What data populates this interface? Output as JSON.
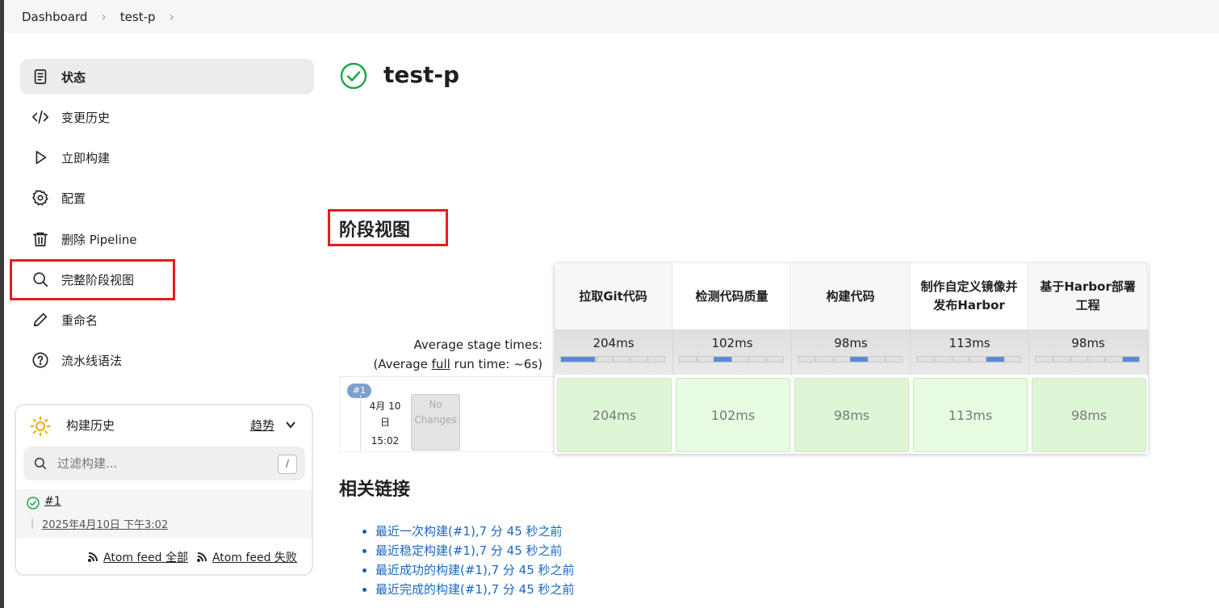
{
  "breadcrumb": {
    "items": [
      "Dashboard",
      "test-p"
    ]
  },
  "sidebar": {
    "items": [
      {
        "label": "状态",
        "icon": "status-doc-icon"
      },
      {
        "label": "变更历史",
        "icon": "code-icon"
      },
      {
        "label": "立即构建",
        "icon": "play-icon"
      },
      {
        "label": "配置",
        "icon": "gear-icon"
      },
      {
        "label": "删除 Pipeline",
        "icon": "trash-icon"
      },
      {
        "label": "完整阶段视图",
        "icon": "search-icon"
      },
      {
        "label": "重命名",
        "icon": "pencil-icon"
      },
      {
        "label": "流水线语法",
        "icon": "help-icon"
      }
    ]
  },
  "build_history": {
    "title": "构建历史",
    "trend_label": "趋势",
    "filter_placeholder": "过滤构建...",
    "filter_shortcut": "/",
    "builds": [
      {
        "number": "#1",
        "date": "2025年4月10日 下午3:02",
        "status": "success"
      }
    ],
    "feeds": [
      "Atom feed 全部",
      "Atom feed 失败"
    ]
  },
  "main": {
    "title": "test-p",
    "stage_view_title": "阶段视图",
    "avg_stage_label": "Average stage times:",
    "avg_full_prefix": "(Average ",
    "avg_full_link": "full",
    "avg_full_suffix": " run time: ~6s)",
    "stages": [
      {
        "name": "拉取Git代码",
        "avg": "204ms",
        "run": "204ms",
        "progress_start": 0.0,
        "progress_end": 0.33
      },
      {
        "name": "检测代码质量",
        "avg": "102ms",
        "run": "102ms",
        "progress_start": 0.33,
        "progress_end": 0.5
      },
      {
        "name": "构建代码",
        "avg": "98ms",
        "run": "98ms",
        "progress_start": 0.5,
        "progress_end": 0.67
      },
      {
        "name": "制作自定义镜像并发布Harbor",
        "avg": "113ms",
        "run": "113ms",
        "progress_start": 0.67,
        "progress_end": 0.84
      },
      {
        "name": "基于Harbor部署工程",
        "avg": "98ms",
        "run": "98ms",
        "progress_start": 0.84,
        "progress_end": 1.0
      }
    ],
    "run": {
      "badge": "#1",
      "date_line1": "4月 10",
      "date_line2": "日",
      "time": "15:02",
      "no_changes": "No Changes"
    },
    "related_title": "相关链接",
    "related_links": [
      "最近一次构建(#1),7 分 45 秒之前",
      "最近稳定构建(#1),7 分 45 秒之前",
      "最近成功的构建(#1),7 分 45 秒之前",
      "最近完成的构建(#1),7 分 45 秒之前"
    ]
  },
  "colors": {
    "success": "#1ea64a",
    "highlight_box": "#e81c1c",
    "link": "#1867c0",
    "stage_success": "#dff6d6"
  }
}
